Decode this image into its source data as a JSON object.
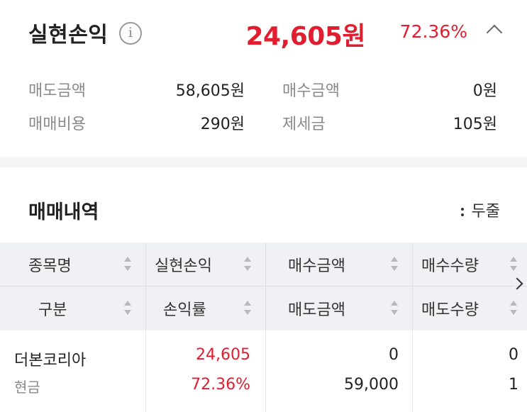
{
  "summary": {
    "title": "실현손익",
    "info_icon": "info-icon",
    "amount": "24,605원",
    "percent": "72.36%",
    "collapse_icon": "chevron-up-icon",
    "accent_color": "#e01e2f",
    "metrics": {
      "sell_amount_label": "매도금액",
      "sell_amount_value": "58,605원",
      "buy_amount_label": "매수금액",
      "buy_amount_value": "0원",
      "fee_label": "매매비용",
      "fee_value": "290원",
      "tax_label": "제세금",
      "tax_value": "105원"
    }
  },
  "history": {
    "title": "매매내역",
    "view_toggle": "두줄",
    "headers_row1": [
      "종목명",
      "실현손익",
      "매수금액",
      "매수수량"
    ],
    "headers_row2": [
      "구분",
      "손익률",
      "매도금액",
      "매도수량"
    ],
    "rows": [
      {
        "name": "더본코리아",
        "type": "현금",
        "profit": "24,605",
        "rate": "72.36%",
        "buy_amount": "0",
        "sell_amount": "59,000",
        "buy_qty": "0",
        "sell_qty": "1"
      }
    ]
  }
}
